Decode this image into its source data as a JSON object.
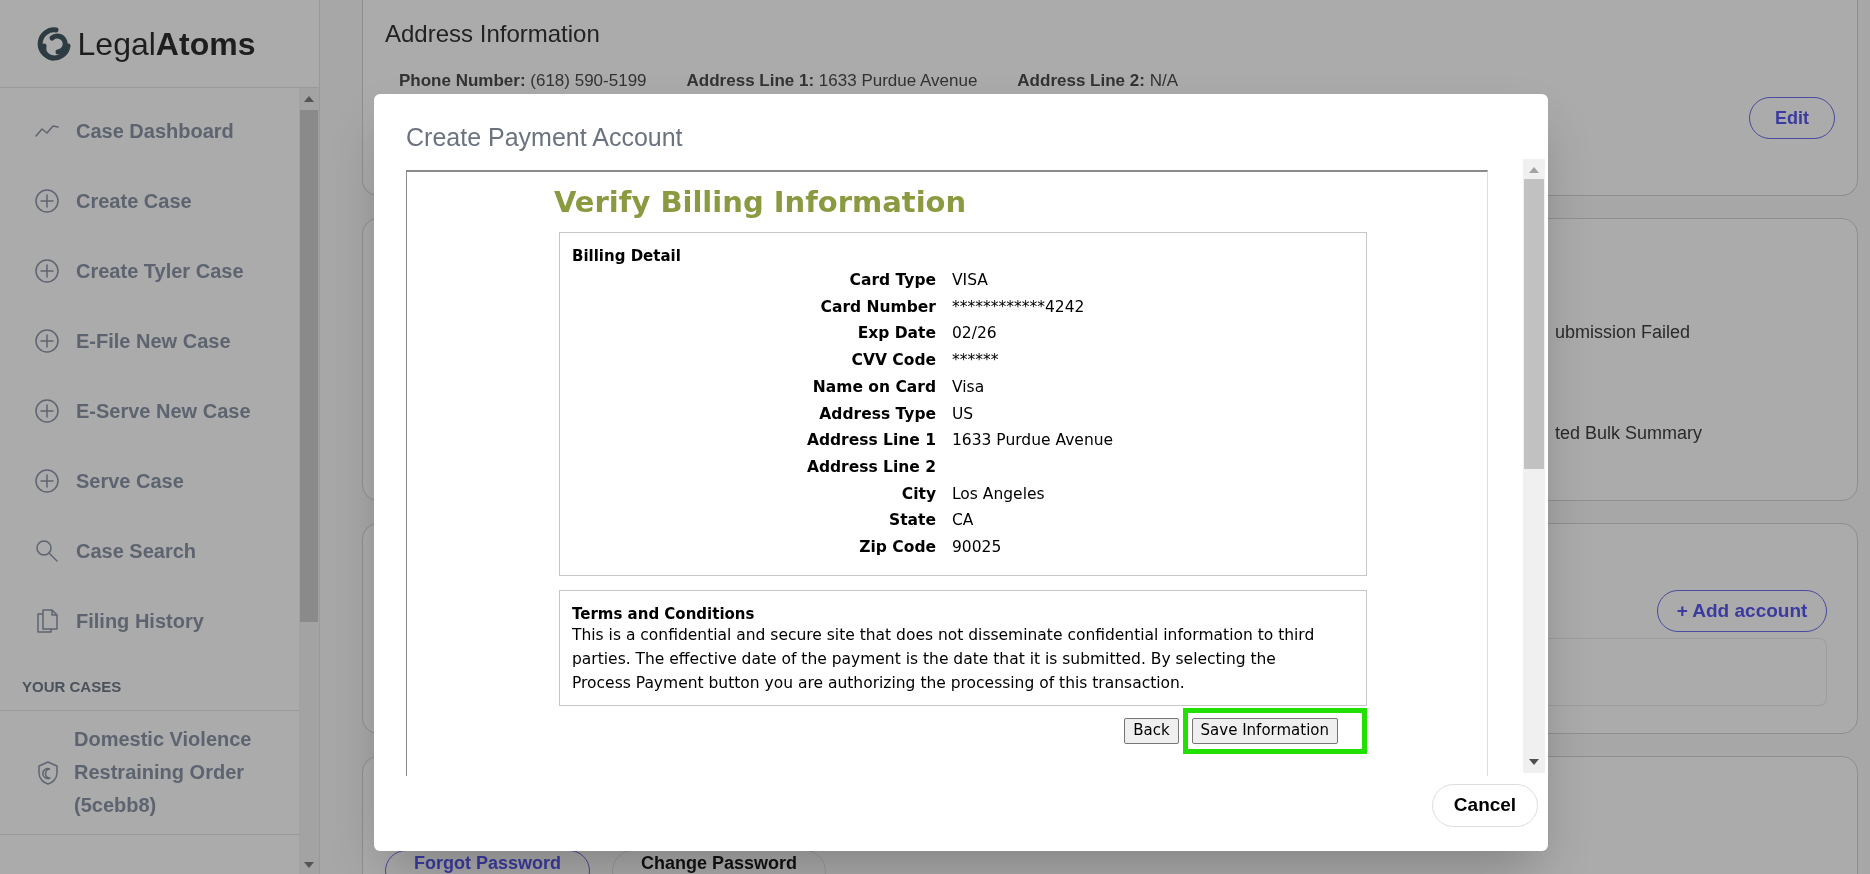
{
  "logo": {
    "regular": "Legal",
    "bold": "Atoms"
  },
  "sidebar": {
    "items": [
      {
        "label": "Case Dashboard",
        "kind": "chart"
      },
      {
        "label": "Create Case",
        "kind": "plus"
      },
      {
        "label": "Create Tyler Case",
        "kind": "plus"
      },
      {
        "label": "E-File New Case",
        "kind": "plus"
      },
      {
        "label": "E-Serve New Case",
        "kind": "plus"
      },
      {
        "label": "Serve Case",
        "kind": "plus"
      },
      {
        "label": "Case Search",
        "kind": "search"
      },
      {
        "label": "Filing History",
        "kind": "document"
      }
    ],
    "section_title": "YOUR CASES",
    "cases": [
      {
        "label": "Domestic Violence Restraining Order (5cebb8)"
      }
    ]
  },
  "background": {
    "address_card": {
      "title": "Address Information",
      "fields": [
        {
          "label": "Phone Number:",
          "value": "(618) 590-5199"
        },
        {
          "label": "Address Line 1:",
          "value": "1633 Purdue Avenue"
        },
        {
          "label": "Address Line 2:",
          "value": "N/A"
        }
      ],
      "edit_button": "Edit"
    },
    "status_items": [
      "ubmission Failed",
      "ted Bulk Summary"
    ],
    "add_account_button": "+ Add account",
    "account_buttons": [
      {
        "label": "Forgot Password",
        "kind": "primary"
      },
      {
        "label": "Change Password",
        "kind": "secondary"
      }
    ]
  },
  "dialog": {
    "title": "Create Payment Account",
    "heading": "Verify Billing Information",
    "billing": {
      "title": "Billing Detail",
      "rows": [
        {
          "label": "Card Type",
          "value": "VISA"
        },
        {
          "label": "Card Number",
          "value": "************4242"
        },
        {
          "label": "Exp Date",
          "value": "02/26"
        },
        {
          "label": "CVV Code",
          "value": "******"
        },
        {
          "label": "Name on Card",
          "value": "Visa"
        },
        {
          "label": "Address Type",
          "value": "US"
        },
        {
          "label": "Address Line 1",
          "value": "1633 Purdue Avenue"
        },
        {
          "label": "Address Line 2"
        },
        {
          "label": "City",
          "value": "Los Angeles"
        },
        {
          "label": "State",
          "value": "CA"
        },
        {
          "label": "Zip Code",
          "value": "90025"
        }
      ]
    },
    "terms": {
      "title": "Terms and Conditions",
      "text": "This is a confidential and secure site that does not disseminate confidential information to third parties. The effective date of the payment is the date that it is submitted. By selecting the Process Payment button you are authorizing the processing of this transaction."
    },
    "buttons": [
      {
        "label": "Back",
        "highlighted": false
      },
      {
        "label": "Save Information",
        "highlighted": true
      }
    ],
    "cancel": "Cancel"
  }
}
